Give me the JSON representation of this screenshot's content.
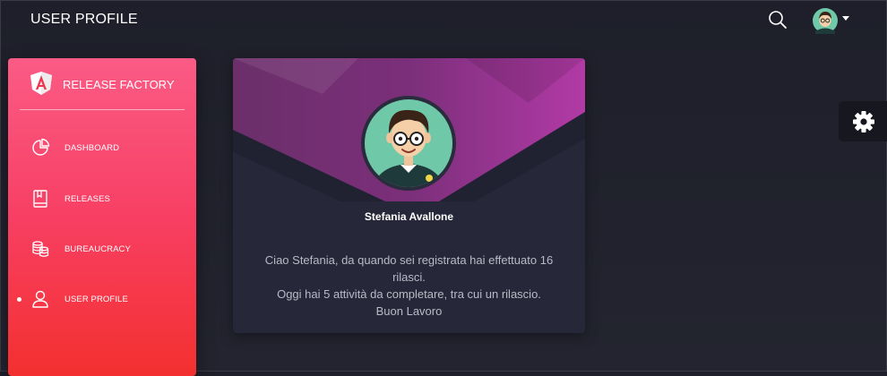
{
  "header": {
    "title": "USER PROFILE"
  },
  "icons": {
    "search": "search-icon",
    "avatar": "user-avatar-icon",
    "caret": "caret-down-icon",
    "settings": "gear-icon"
  },
  "sidebar": {
    "brand": "RELEASE FACTORY",
    "items": [
      {
        "label": "DASHBOARD",
        "icon": "pie-chart-icon",
        "active": false
      },
      {
        "label": "RELEASES",
        "icon": "book-icon",
        "active": false
      },
      {
        "label": "BUREAUCRACY",
        "icon": "coins-icon",
        "active": false
      },
      {
        "label": "USER PROFILE",
        "icon": "user-icon",
        "active": true
      }
    ]
  },
  "profile": {
    "name": "Stefania Avallone",
    "message_lines": [
      "Ciao Stefania, da quando sei registrata hai effettuato 16",
      "rilasci.",
      "Oggi hai 5 attività da completare, tra cui un rilascio.",
      "Buon Lavoro"
    ]
  },
  "colors": {
    "accent_start": "#fa5b85",
    "accent_end": "#f3302f",
    "background": "#1f1f2b",
    "card": "#262738",
    "card_header": "#8e2f8a"
  }
}
